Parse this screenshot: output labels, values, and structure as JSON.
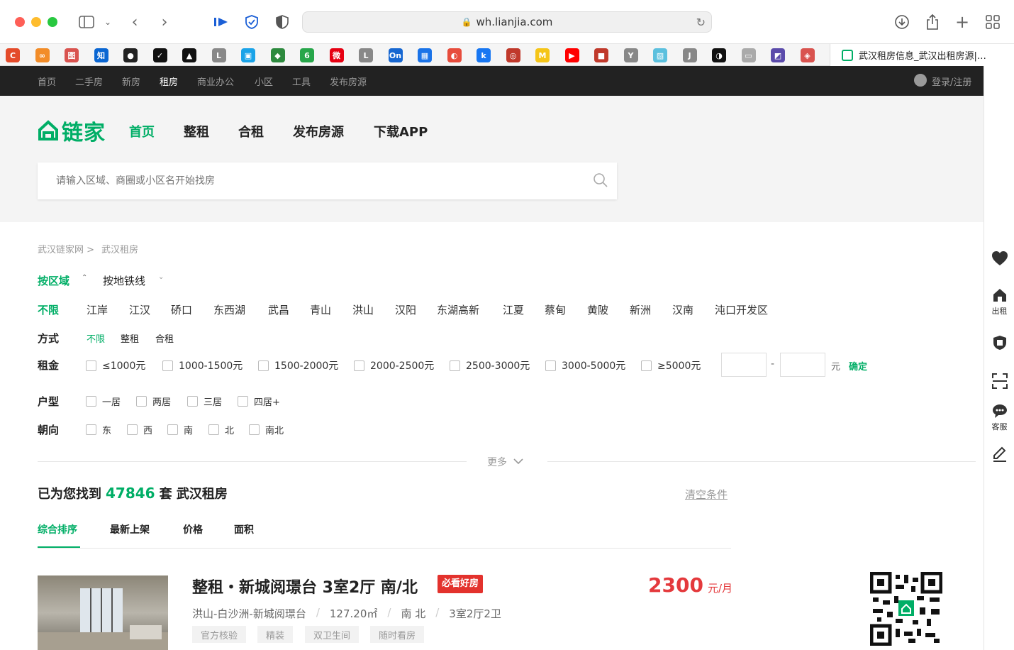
{
  "browser": {
    "url": "wh.lianjia.com",
    "tab_title": "武汉租房信息_武汉出租房源|…",
    "bookmarks": [
      {
        "label": "C",
        "color": "#e44b2a"
      },
      {
        "label": "∞",
        "color": "#f28c28"
      },
      {
        "label": "图",
        "color": "#d9534f"
      },
      {
        "label": "知",
        "color": "#0a66d2"
      },
      {
        "label": "●",
        "color": "#222"
      },
      {
        "label": "✓",
        "color": "#111"
      },
      {
        "label": "▲",
        "color": "#111"
      },
      {
        "label": "L",
        "color": "#888"
      },
      {
        "label": "▣",
        "color": "#1aa3e8"
      },
      {
        "label": "◆",
        "color": "#2d8a3e"
      },
      {
        "label": "6",
        "color": "#27a64a"
      },
      {
        "label": "微",
        "color": "#e60012"
      },
      {
        "label": "L",
        "color": "#888"
      },
      {
        "label": "On",
        "color": "#1767d1"
      },
      {
        "label": "▦",
        "color": "#1a73e8"
      },
      {
        "label": "◐",
        "color": "#e74c3c"
      },
      {
        "label": "k",
        "color": "#1877f2"
      },
      {
        "label": "◎",
        "color": "#c0392b"
      },
      {
        "label": "M",
        "color": "#f5c518"
      },
      {
        "label": "▶",
        "color": "#ff0000"
      },
      {
        "label": "■",
        "color": "#c0392b"
      },
      {
        "label": "Y",
        "color": "#888"
      },
      {
        "label": "▨",
        "color": "#5bc0de"
      },
      {
        "label": "J",
        "color": "#888"
      },
      {
        "label": "◑",
        "color": "#111"
      },
      {
        "label": "▭",
        "color": "#aaa"
      },
      {
        "label": "◩",
        "color": "#5b4bab"
      },
      {
        "label": "◈",
        "color": "#d9534f"
      }
    ]
  },
  "topnav": {
    "items": [
      "首页",
      "二手房",
      "新房",
      "租房",
      "商业办公",
      "小区",
      "工具",
      "发布房源"
    ],
    "active_index": 3,
    "login": "登录/注册"
  },
  "header": {
    "logo": "链家",
    "nav": [
      "首页",
      "整租",
      "合租",
      "发布房源",
      "下载APP"
    ],
    "active_index": 0,
    "search_placeholder": "请输入区域、商圈或小区名开始找房"
  },
  "breadcrumb": [
    "武汉链家网 >",
    "武汉租房"
  ],
  "filter": {
    "tabs": [
      "按区域",
      "按地铁线"
    ],
    "districts_label": "不限",
    "districts": [
      "江岸",
      "江汉",
      "硚口",
      "东西湖",
      "武昌",
      "青山",
      "洪山",
      "汉阳",
      "东湖高新",
      "江夏",
      "蔡甸",
      "黄陂",
      "新洲",
      "汉南",
      "沌口开发区"
    ],
    "mode_label": "方式",
    "modes": [
      "不限",
      "整租",
      "合租"
    ],
    "rent_label": "租金",
    "rent_options": [
      "≤1000元",
      "1000-1500元",
      "1500-2000元",
      "2000-2500元",
      "2500-3000元",
      "3000-5000元",
      "≥5000元"
    ],
    "rent_unit": "元",
    "rent_confirm": "确定",
    "layout_label": "户型",
    "layout_options": [
      "一居",
      "两居",
      "三居",
      "四居+"
    ],
    "orient_label": "朝向",
    "orient_options": [
      "东",
      "西",
      "南",
      "北",
      "南北"
    ],
    "more": "更多"
  },
  "results": {
    "prefix": "已为您找到",
    "count": "47846",
    "suffix": "套 武汉租房",
    "clear": "清空条件",
    "sort_tabs": [
      "综合排序",
      "最新上架",
      "价格",
      "面积"
    ]
  },
  "listing": {
    "title": "整租・新城阅璟台 3室2厅 南/北",
    "badge": "必看好房",
    "location": "洪山-白沙洲-新城阅璟台",
    "area": "127.20㎡",
    "orientation": "南 北",
    "rooms": "3室2厅2卫",
    "price": "2300",
    "price_unit": "元/月",
    "tags": [
      "官方核验",
      "精装",
      "双卫生间",
      "随时看房"
    ]
  },
  "sidebar": {
    "items": [
      {
        "icon": "heart-icon",
        "label": ""
      },
      {
        "icon": "house-icon",
        "label": "出租"
      },
      {
        "icon": "shield-icon",
        "label": ""
      },
      {
        "icon": "scan-icon",
        "label": ""
      },
      {
        "icon": "chat-icon",
        "label": "客服"
      },
      {
        "icon": "edit-icon",
        "label": ""
      }
    ]
  }
}
